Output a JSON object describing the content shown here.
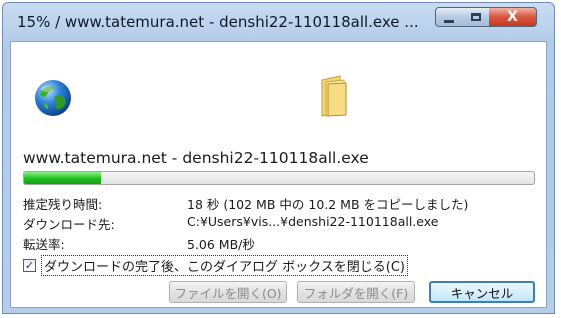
{
  "window": {
    "title": "15% / www.tatemura.net - denshi22-110118all.exe ...",
    "controls": {
      "close": "X"
    }
  },
  "download": {
    "filename": "www.tatemura.net - denshi22-110118all.exe",
    "progress_percent": 15,
    "rows": [
      {
        "label": "推定残り時間:",
        "value": "18 秒 (102 MB 中の 10.2 MB をコピーしました)"
      },
      {
        "label": "ダウンロード先:",
        "value": "C:¥Users¥vis...¥denshi22-110118all.exe"
      },
      {
        "label": "転送率:",
        "value": "5.06 MB/秒"
      }
    ],
    "close_on_complete": {
      "label": "ダウンロードの完了後、このダイアログ ボックスを閉じる(C)",
      "checked": true,
      "check_glyph": "✓"
    }
  },
  "buttons": {
    "open_file": "ファイルを開く(O)",
    "open_folder": "フォルダを開く(F)",
    "cancel": "キャンセル"
  },
  "colors": {
    "progress": "#22c022",
    "title_bar": "#b9cfea",
    "close_button": "#d04b33"
  }
}
